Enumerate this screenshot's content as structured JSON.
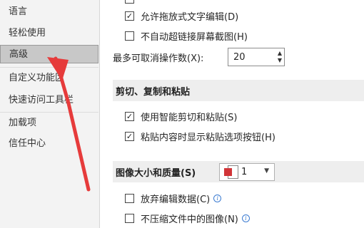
{
  "sidebar": {
    "items": [
      {
        "label": "语言"
      },
      {
        "label": "轻松使用"
      },
      {
        "label": "高级"
      },
      {
        "label": "自定义功能区"
      },
      {
        "label": "快速访问工具栏"
      },
      {
        "label": "加载项"
      },
      {
        "label": "信任中心"
      }
    ],
    "selected_index": 2
  },
  "editing": {
    "allow_drag_drop": {
      "label": "允许拖放式文字编辑(D)",
      "checked": true
    },
    "no_auto_hyperlink": {
      "label": "不自动超链接屏幕截图(H)",
      "checked": false
    },
    "undo_count": {
      "label": "最多可取消操作数(X):",
      "value": "20"
    }
  },
  "cut_copy_paste": {
    "title": "剪切、复制和粘贴",
    "smart_cut": {
      "label": "使用智能剪切和粘贴(S)",
      "checked": true
    },
    "show_paste_button": {
      "label": "粘贴内容时显示粘贴选项按钮(H)",
      "checked": true
    }
  },
  "image_quality": {
    "title": "图像大小和质量(S)",
    "file_value": "1",
    "discard_edit_data": {
      "label": "放弃编辑数据(C)",
      "checked": false
    },
    "no_compress": {
      "label": "不压缩文件中的图像(N)",
      "checked": false
    }
  },
  "colors": {
    "annotation_arrow": "#e63b3b",
    "selected_bg": "#c8c8c8",
    "info_blue": "#3b7bd1"
  }
}
